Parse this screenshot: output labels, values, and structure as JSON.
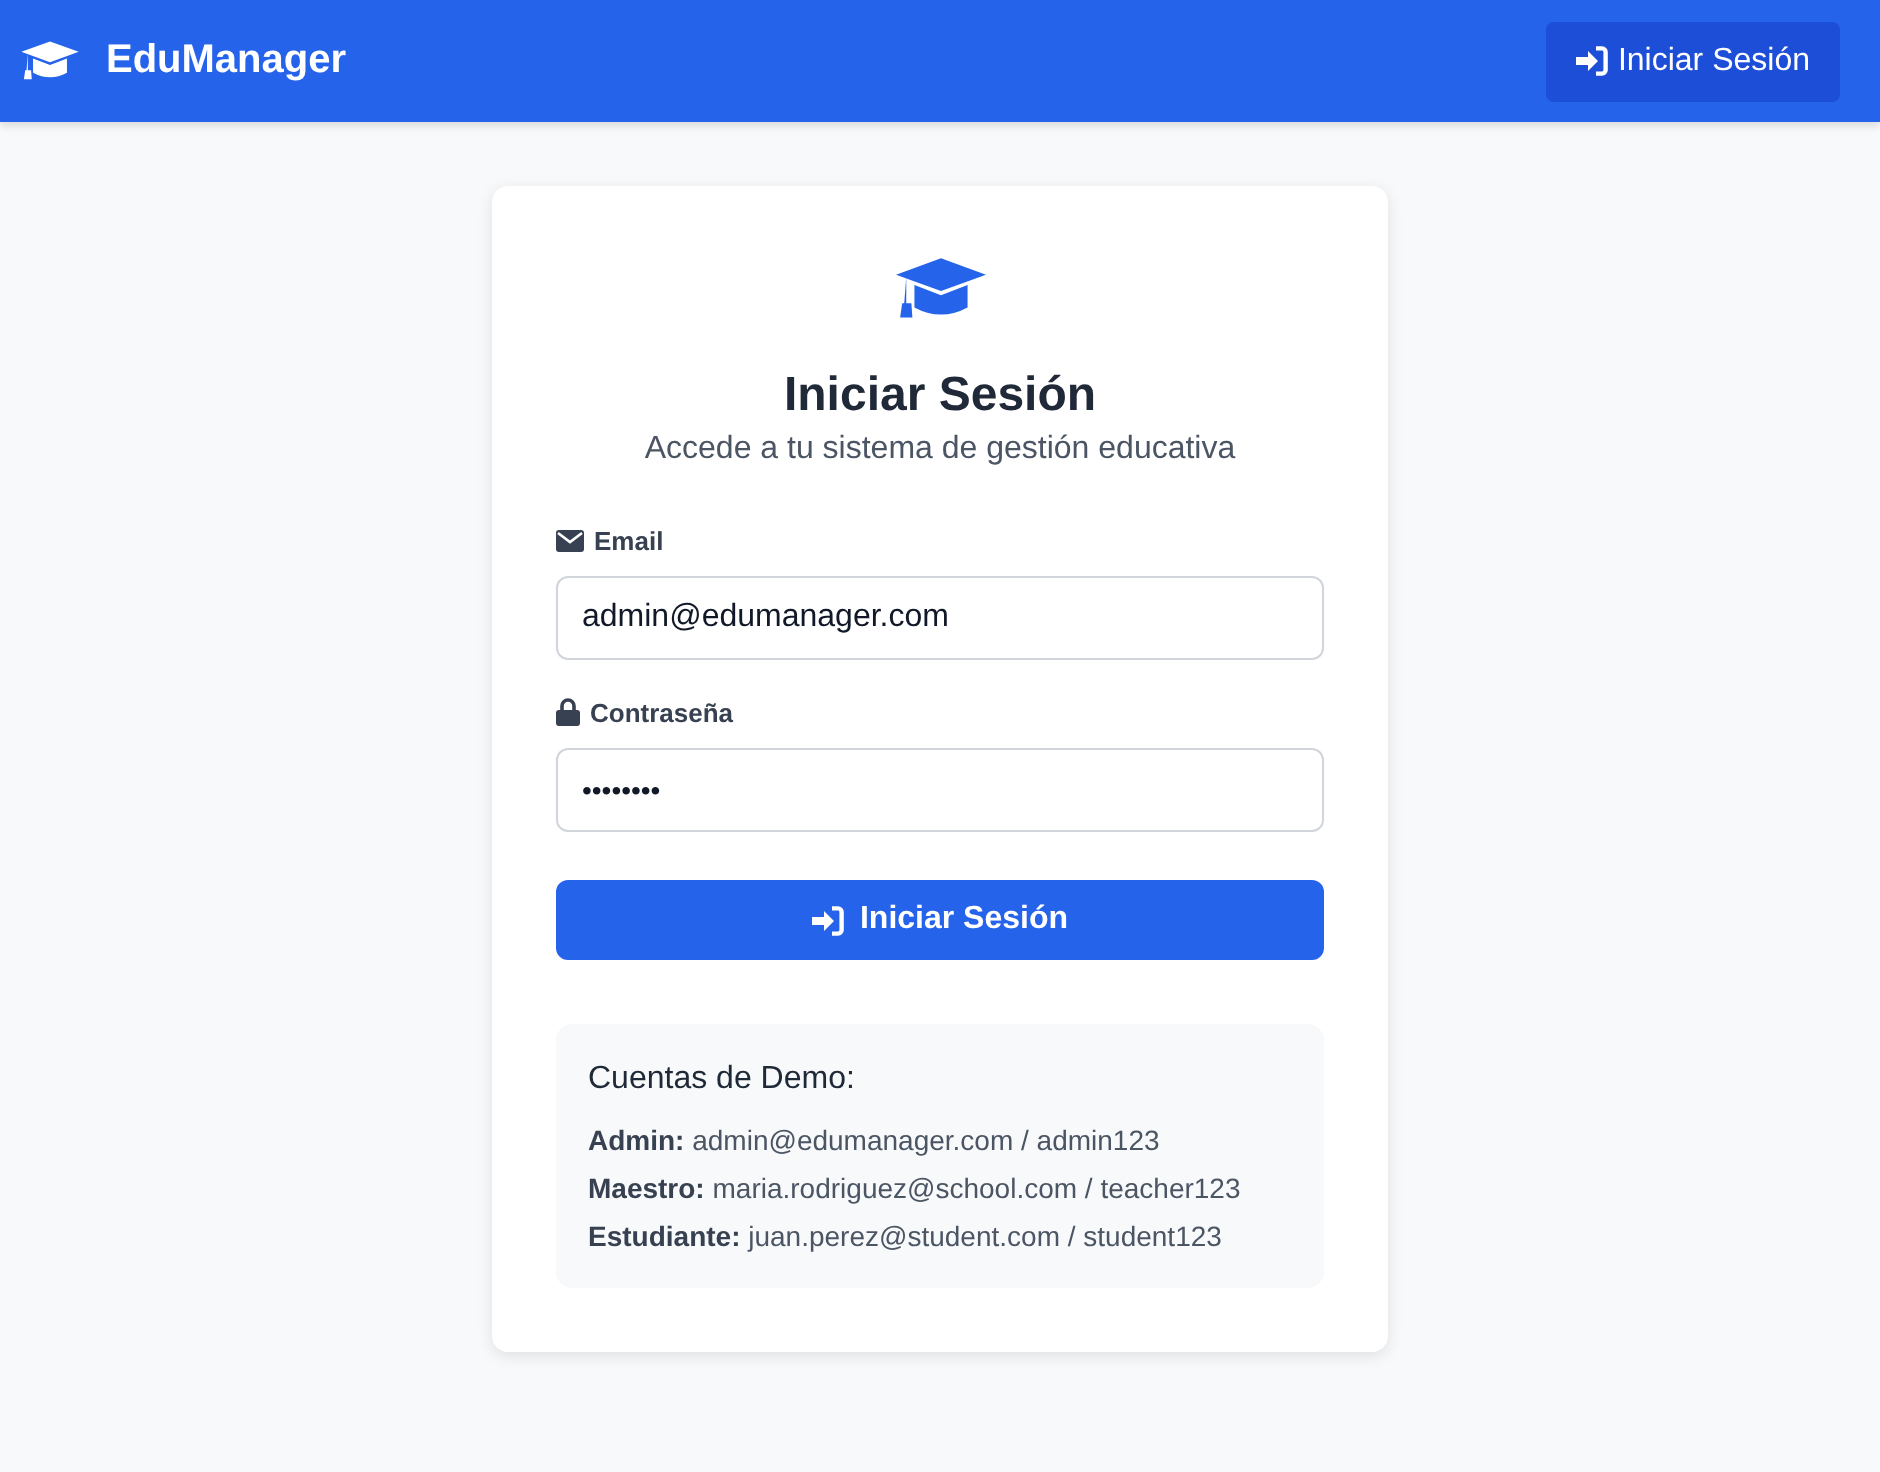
{
  "navbar": {
    "brand": "EduManager",
    "login_button": "Iniciar Sesión"
  },
  "login_card": {
    "title": "Iniciar Sesión",
    "subtitle": "Accede a tu sistema de gestión educativa",
    "fields": [
      {
        "kind": "email",
        "label": "Email",
        "value": "admin@edumanager.com"
      },
      {
        "kind": "password",
        "label": "Contraseña",
        "value": "••••••••"
      }
    ],
    "submit_button": "Iniciar Sesión",
    "demo_accounts": {
      "title": "Cuentas de Demo:",
      "accounts": [
        "**Admin:** admin@edumanager.com / admin123",
        "**Maestro:** maria.rodriguez@school.com / teacher123",
        "**Estudiante:** juan.perez@student.com / student123"
      ]
    }
  }
}
